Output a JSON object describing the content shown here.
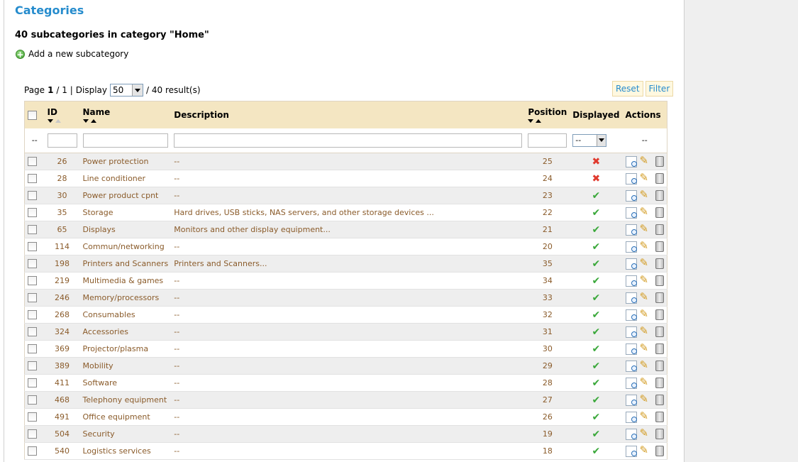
{
  "page": {
    "title": "Categories",
    "subtitle": "40 subcategories in category \"Home\"",
    "add_label": "Add a new subcategory"
  },
  "pager": {
    "page_label": "Page",
    "current": "1",
    "total_sep": "/ 1 |",
    "display_label": "Display",
    "display_value": "50",
    "results": "/ 40 result(s)"
  },
  "buttons": {
    "reset": "Reset",
    "filter": "Filter"
  },
  "columns": {
    "id": "ID",
    "name": "Name",
    "description": "Description",
    "position": "Position",
    "displayed": "Displayed",
    "actions": "Actions"
  },
  "filter_row": {
    "dash": "--",
    "displayed_value": "--",
    "actions_dash": "--"
  },
  "rows": [
    {
      "id": "26",
      "name": "Power protection",
      "description": "--",
      "position": "25",
      "displayed": false
    },
    {
      "id": "28",
      "name": "Line conditioner",
      "description": "--",
      "position": "24",
      "displayed": false
    },
    {
      "id": "30",
      "name": "Power product cpnt",
      "description": "--",
      "position": "23",
      "displayed": true
    },
    {
      "id": "35",
      "name": "Storage",
      "description": "Hard drives, USB sticks, NAS servers, and other storage devices ...",
      "position": "22",
      "displayed": true
    },
    {
      "id": "65",
      "name": "Displays",
      "description": "Monitors and other display equipment...",
      "position": "21",
      "displayed": true
    },
    {
      "id": "114",
      "name": "Commun/networking",
      "description": "--",
      "position": "20",
      "displayed": true
    },
    {
      "id": "198",
      "name": "Printers and Scanners",
      "description": "Printers and Scanners...",
      "position": "35",
      "displayed": true
    },
    {
      "id": "219",
      "name": "Multimedia & games",
      "description": "--",
      "position": "34",
      "displayed": true
    },
    {
      "id": "246",
      "name": "Memory/processors",
      "description": "--",
      "position": "33",
      "displayed": true
    },
    {
      "id": "268",
      "name": "Consumables",
      "description": "--",
      "position": "32",
      "displayed": true
    },
    {
      "id": "324",
      "name": "Accessories",
      "description": "--",
      "position": "31",
      "displayed": true
    },
    {
      "id": "369",
      "name": "Projector/plasma",
      "description": "--",
      "position": "30",
      "displayed": true
    },
    {
      "id": "389",
      "name": "Mobility",
      "description": "--",
      "position": "29",
      "displayed": true
    },
    {
      "id": "411",
      "name": "Software",
      "description": "--",
      "position": "28",
      "displayed": true
    },
    {
      "id": "468",
      "name": "Telephony equipment",
      "description": "--",
      "position": "27",
      "displayed": true
    },
    {
      "id": "491",
      "name": "Office equipment",
      "description": "--",
      "position": "26",
      "displayed": true
    },
    {
      "id": "504",
      "name": "Security",
      "description": "--",
      "position": "19",
      "displayed": true
    },
    {
      "id": "540",
      "name": "Logistics services",
      "description": "--",
      "position": "18",
      "displayed": true
    }
  ],
  "icons": {
    "displayed_true": "check-icon",
    "displayed_false": "cross-icon",
    "actions": [
      "view-icon",
      "edit-icon",
      "delete-icon"
    ],
    "add": "add-icon"
  },
  "colors": {
    "title": "#268ccd",
    "header_bg": "#f4e6c2",
    "row_text": "#8a5b2a",
    "check": "#3aa83a",
    "cross": "#e03a2e"
  }
}
